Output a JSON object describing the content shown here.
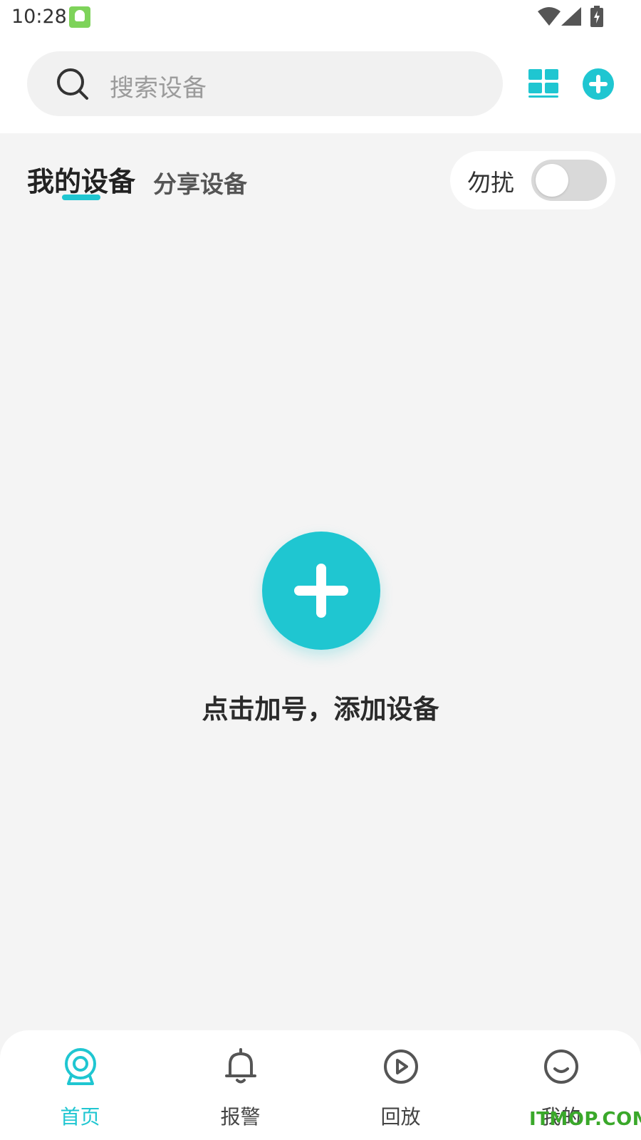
{
  "status_bar": {
    "time": "10:28"
  },
  "search": {
    "placeholder": "搜索设备"
  },
  "tabs": {
    "my_devices": "我的设备",
    "shared_devices": "分享设备"
  },
  "dnd": {
    "label": "勿扰",
    "enabled": false
  },
  "empty_state": {
    "hint": "点击加号，添加设备"
  },
  "bottom_nav": [
    {
      "label": "首页",
      "icon": "camera-icon",
      "active": true
    },
    {
      "label": "报警",
      "icon": "bell-icon",
      "active": false
    },
    {
      "label": "回放",
      "icon": "play-circle-icon",
      "active": false
    },
    {
      "label": "我的",
      "icon": "smile-icon",
      "active": false
    }
  ],
  "watermark": "ITMOP.COM",
  "colors": {
    "accent": "#1fc6d1",
    "background": "#f4f4f4"
  }
}
